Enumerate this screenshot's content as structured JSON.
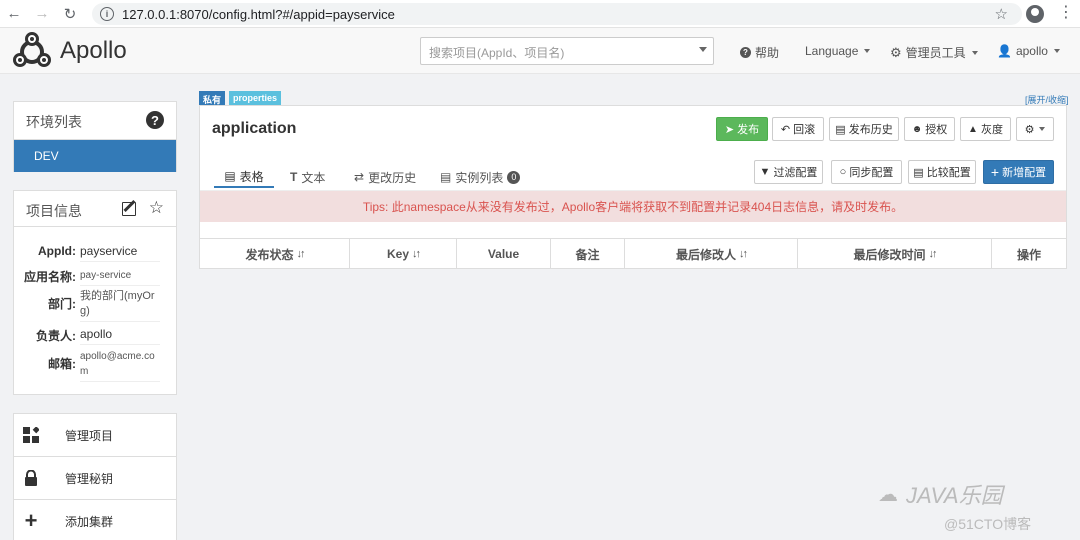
{
  "browser": {
    "url": "127.0.0.1:8070/config.html?#/appid=payservice"
  },
  "navbar": {
    "logo_text": "Apollo",
    "search_placeholder": "搜索项目(AppId、项目名)",
    "help": "帮助",
    "language": "Language",
    "admin_tools": "管理员工具",
    "user": "apollo"
  },
  "sidebar": {
    "env_title": "环境列表",
    "env_items": [
      "DEV"
    ],
    "info_title": "项目信息",
    "info": [
      {
        "key": "AppId:",
        "value": "payservice"
      },
      {
        "key": "应用名称:",
        "value": "pay-service"
      },
      {
        "key": "部门:",
        "value": "我的部门(myOrg)"
      },
      {
        "key": "负责人:",
        "value": "apollo"
      },
      {
        "key": "邮箱:",
        "value": "apollo@acme.com"
      }
    ],
    "mgmt": [
      {
        "label": "管理项目",
        "icon": "apps-icon"
      },
      {
        "label": "管理秘钥",
        "icon": "lock-icon"
      },
      {
        "label": "添加集群",
        "icon": "plus-icon"
      }
    ]
  },
  "namespace": {
    "badge_private": "私有",
    "badge_format": "properties",
    "expand_collapse": "[展开/收缩]",
    "title": "application",
    "buttons": {
      "publish": "发布",
      "rollback": "回滚",
      "release_history": "发布历史",
      "authorize": "授权",
      "gray": "灰度"
    },
    "tabs": {
      "table": "表格",
      "text": "文本",
      "history": "更改历史",
      "instances": "实例列表",
      "instances_count": "0"
    },
    "tab_buttons": {
      "filter": "过滤配置",
      "sync": "同步配置",
      "compare": "比较配置",
      "add": "新增配置"
    },
    "tips": "Tips: 此namespace从来没有发布过，Apollo客户端将获取不到配置并记录404日志信息，请及时发布。",
    "columns": [
      "发布状态",
      "Key",
      "Value",
      "备注",
      "最后修改人",
      "最后修改时间",
      "操作"
    ]
  },
  "watermark": {
    "brand": "JAVA乐园",
    "site": "@51CTO博客"
  },
  "colors": {
    "primary": "#337ab7",
    "success": "#5cb85c",
    "tips_bg": "#f2dede",
    "tips_text": "#d9534f",
    "badge_private": "#337ab7",
    "badge_format": "#5bc0de"
  }
}
